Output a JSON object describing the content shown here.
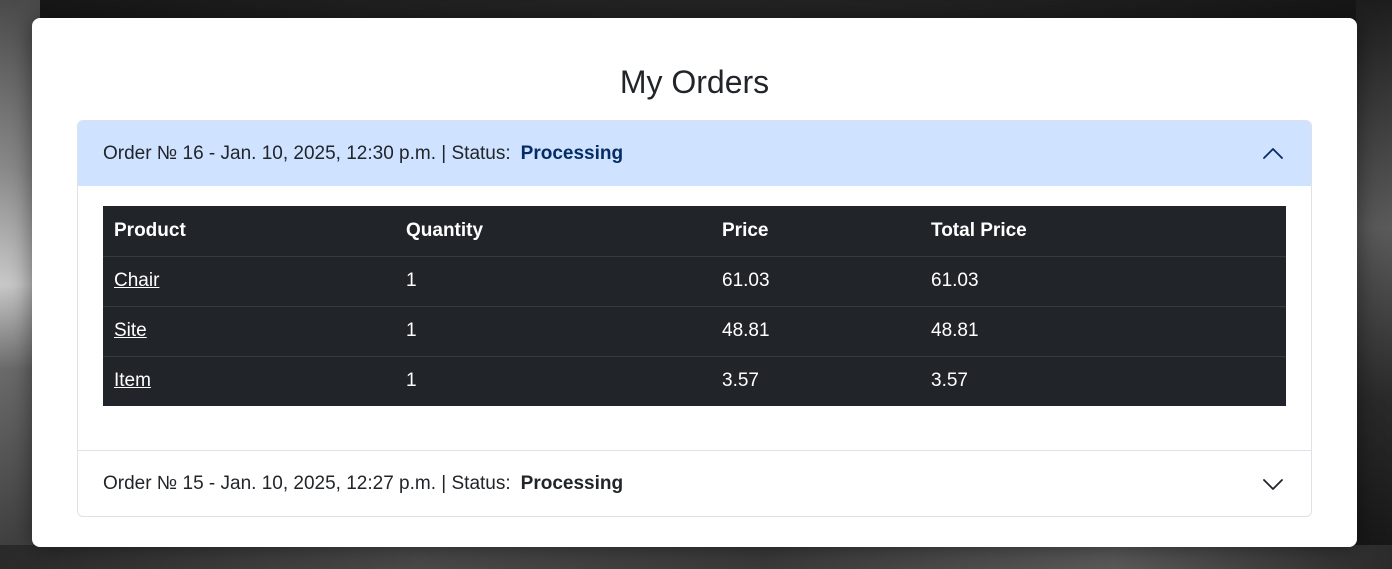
{
  "page": {
    "title": "My Orders"
  },
  "orders": [
    {
      "header": "Order № 16 - Jan. 10, 2025, 12:30 p.m. | Status:",
      "status": "Processing",
      "expanded": true
    },
    {
      "header": "Order № 15 - Jan. 10, 2025, 12:27 p.m. | Status:",
      "status": "Processing",
      "expanded": false
    }
  ],
  "table": {
    "headers": [
      "Product",
      "Quantity",
      "Price",
      "Total Price"
    ],
    "rows": [
      [
        "Chair",
        "1",
        "61.03",
        "61.03"
      ],
      [
        "Site",
        "1",
        "48.81",
        "48.81"
      ],
      [
        "Item",
        "1",
        "3.57",
        "3.57"
      ]
    ]
  },
  "colors": {
    "accordion_active_bg": "#cfe2ff",
    "accordion_active_text": "#052c65",
    "table_dark_bg": "#212529"
  },
  "icons": {
    "expanded": "chevron-up-icon",
    "collapsed": "chevron-down-icon"
  }
}
